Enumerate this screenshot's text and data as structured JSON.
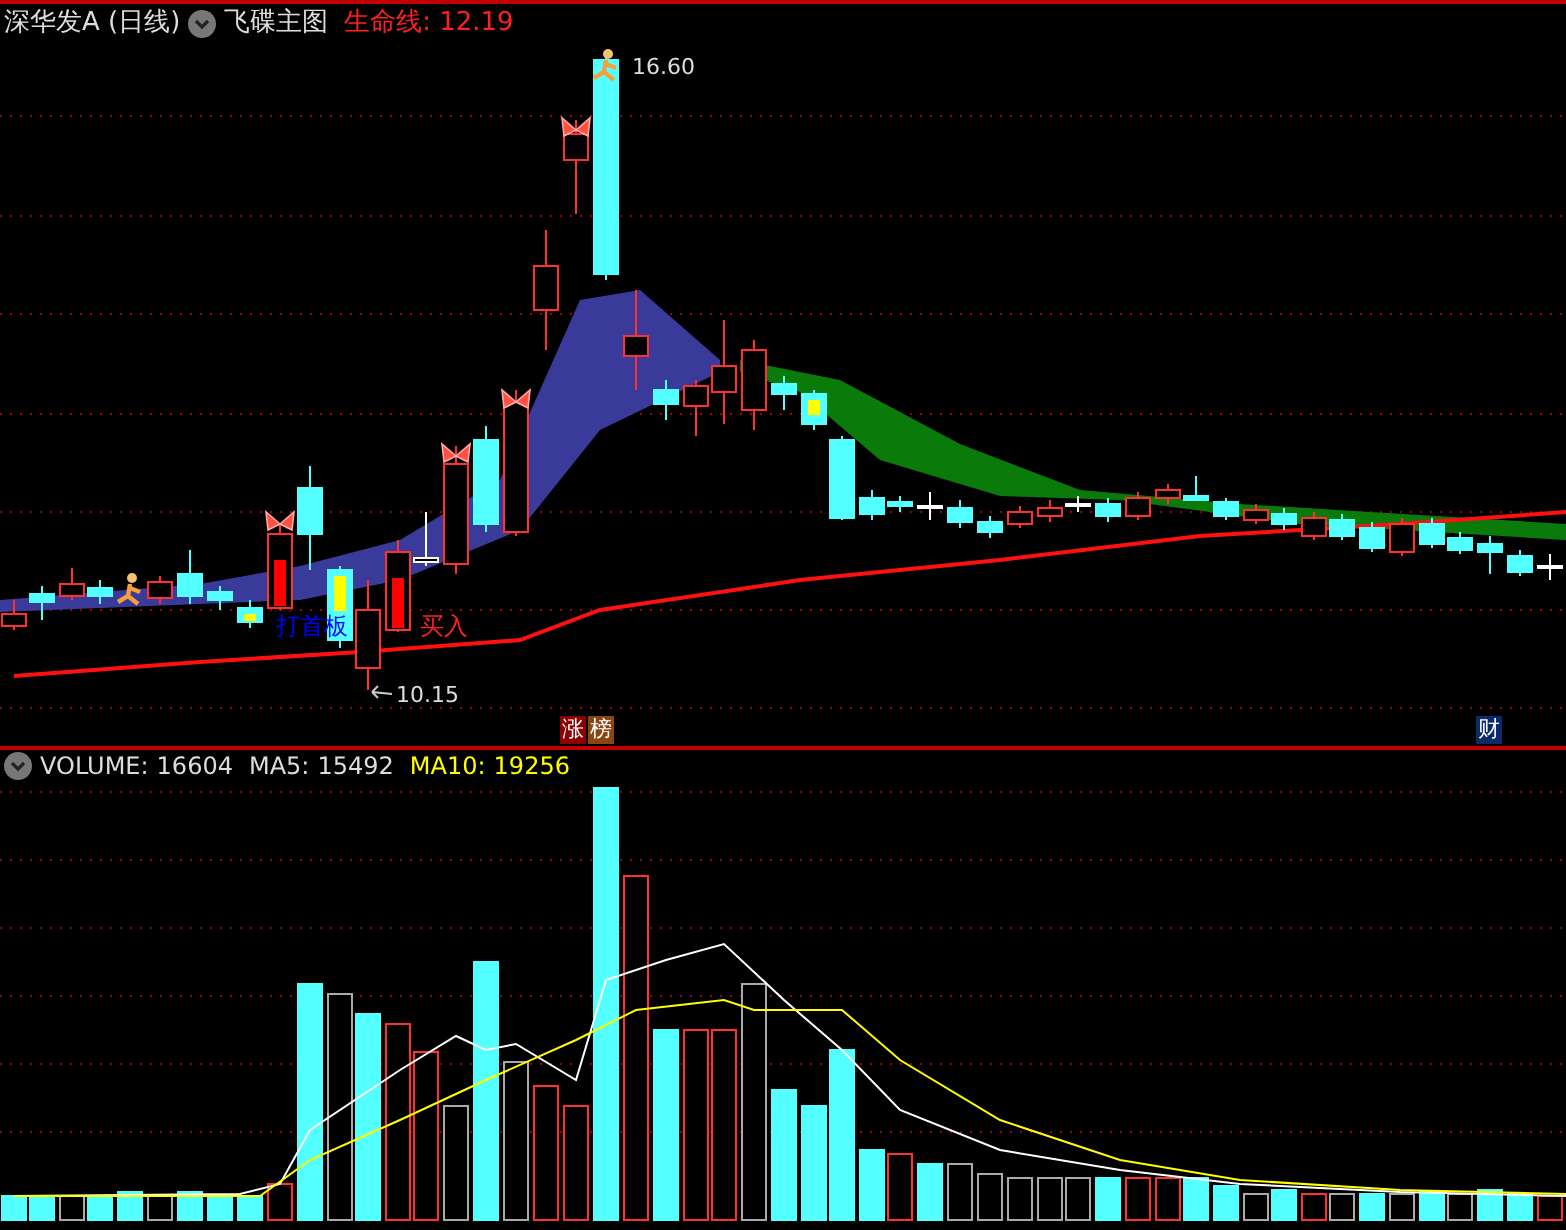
{
  "header": {
    "title": "深华发A (日线)",
    "indicator": "飞碟主图",
    "lifeline_label": "生命线:",
    "lifeline_value": "12.19"
  },
  "main_chart": {
    "high_label": "16.60",
    "low_label": "10.15",
    "signals": [
      {
        "text": "打首板",
        "kind": "first_board"
      },
      {
        "text": "买入",
        "kind": "buy"
      }
    ],
    "badges": [
      {
        "text": "涨",
        "color": "#8b0000"
      },
      {
        "text": "榜",
        "color": "#8b4513"
      },
      {
        "text": "财",
        "color": "#0a2a6a"
      }
    ]
  },
  "volume": {
    "label": "VOLUME:",
    "value": "16604",
    "ma5_label": "MA5:",
    "ma5": "15492",
    "ma10_label": "MA10:",
    "ma10": "19256"
  }
}
